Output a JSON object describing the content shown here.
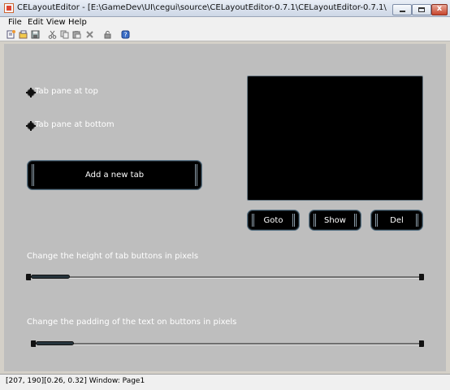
{
  "window": {
    "title": "CELayoutEditor - [E:\\GameDev\\UI\\cegui\\source\\CELayoutEditor-0.7.1\\CELayoutEditor-0.7.1\\bin\\dat...",
    "close_glyph": "x"
  },
  "menu": [
    "File",
    "Edit",
    "View",
    "Help"
  ],
  "toolbar_icons": [
    "new-icon",
    "open-icon",
    "save-icon",
    "cut-icon",
    "copy-icon",
    "paste-icon",
    "delete-icon",
    "lock-icon",
    "help-icon"
  ],
  "layout": {
    "radio_top_label": "Tab pane at top",
    "radio_bottom_label": "Tab pane at bottom",
    "add_tab_label": "Add a new tab",
    "goto_label": "Goto",
    "show_label": "Show",
    "del_label": "Del",
    "height_label": "Change the height of tab buttons in pixels",
    "padding_label": "Change the padding of the text on buttons in pixels",
    "height_slider_fraction": 0.1,
    "padding_slider_fraction": 0.1
  },
  "status": {
    "text": "[207, 190][0.26, 0.32] Window: Page1"
  },
  "colors": {
    "canvas_bg": "#bebebe",
    "widget_bg": "#000000",
    "widget_text": "#ffffff"
  }
}
